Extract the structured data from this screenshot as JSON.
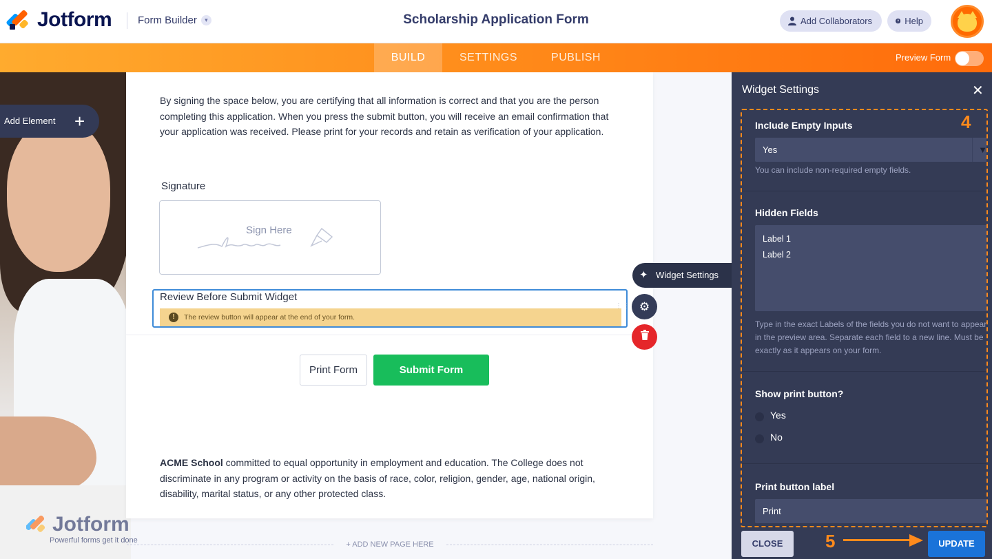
{
  "header": {
    "logo_text": "Jotform",
    "mode": "Form Builder",
    "form_title": "Scholarship Application Form",
    "collaborators_label": "Add Collaborators",
    "help_label": "Help"
  },
  "nav": {
    "tabs": [
      {
        "label": "BUILD",
        "active": true
      },
      {
        "label": "SETTINGS",
        "active": false
      },
      {
        "label": "PUBLISH",
        "active": false
      }
    ],
    "preview_label": "Preview Form",
    "preview_enabled": false
  },
  "canvas": {
    "add_element_label": "Add Element",
    "certification_text": "By signing the space below, you are certifying that all information is correct and that you are the person completing this application. When you press the submit button, you will receive an email confirmation that your application was received. Please print for your records and retain as verification of your application.",
    "signature_label": "Signature",
    "signature_placeholder": "Sign Here",
    "review_widget_title": "Review Before Submit Widget",
    "review_widget_note": "The review button will appear at the end of your form.",
    "print_button": "Print Form",
    "submit_button": "Submit Form",
    "acme_bold": "ACME School",
    "acme_text": " committed to equal opportunity in employment and education. The College does not discriminate in any program or activity on the basis of race, color, religion, gender, age, national origin, disability, marital status, or any other protected class.",
    "widget_settings_pill": "Widget Settings",
    "add_new_page": "+ ADD NEW PAGE HERE",
    "watermark_logo": "Jotform",
    "watermark_tagline": "Powerful forms get it done"
  },
  "panel": {
    "title": "Widget Settings",
    "callout_4": "4",
    "include_empty_label": "Include Empty Inputs",
    "include_empty_value": "Yes",
    "include_empty_help": "You can include non-required empty fields.",
    "hidden_fields_label": "Hidden Fields",
    "hidden_fields_lines": [
      "Label 1",
      "Label 2"
    ],
    "hidden_fields_help": "Type in the exact Labels of the fields you do not want to appear in the preview area. Separate each field to a new line. Must be exactly as it appears on your form.",
    "show_print_label": "Show print button?",
    "show_print_options": [
      "Yes",
      "No"
    ],
    "print_label_label": "Print button label",
    "print_label_value": "Print",
    "close_button": "CLOSE",
    "update_button": "UPDATE",
    "callout_5": "5"
  },
  "colors": {
    "accent_orange": "#ff8a1c",
    "update_blue": "#1a73d9",
    "submit_green": "#18bd5b",
    "panel_bg": "#343b55"
  }
}
